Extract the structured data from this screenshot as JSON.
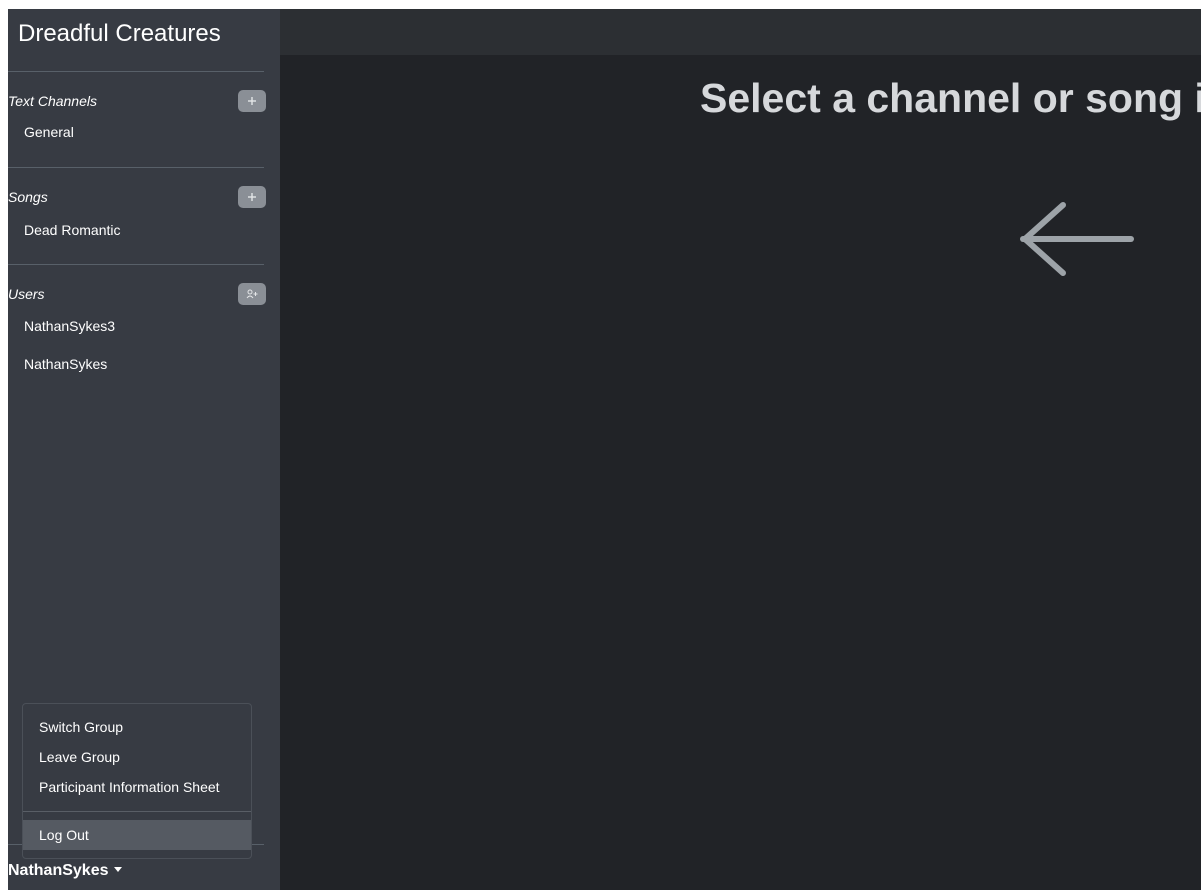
{
  "sidebar": {
    "group_title": "Dreadful Creatures",
    "sections": [
      {
        "label": "Text Channels",
        "action_icon": "plus-icon",
        "items": [
          "General"
        ]
      },
      {
        "label": "Songs",
        "action_icon": "plus-icon",
        "items": [
          "Dead Romantic"
        ]
      },
      {
        "label": "Users",
        "action_icon": "add-user-icon",
        "items": [
          "NathanSykes3",
          "NathanSykes"
        ]
      }
    ]
  },
  "user_menu": {
    "current_user": "NathanSykes",
    "items": [
      "Switch Group",
      "Leave Group",
      "Participant Information Sheet"
    ],
    "logout": "Log Out"
  },
  "main": {
    "prompt": "Select a channel or song i",
    "arrow_icon": "arrow-left-icon"
  },
  "colors": {
    "sidebar_bg": "#373b43",
    "main_bg": "#212327",
    "topbar_bg": "#2c2f33",
    "text": "#ffffff",
    "muted": "#8a8f96"
  }
}
